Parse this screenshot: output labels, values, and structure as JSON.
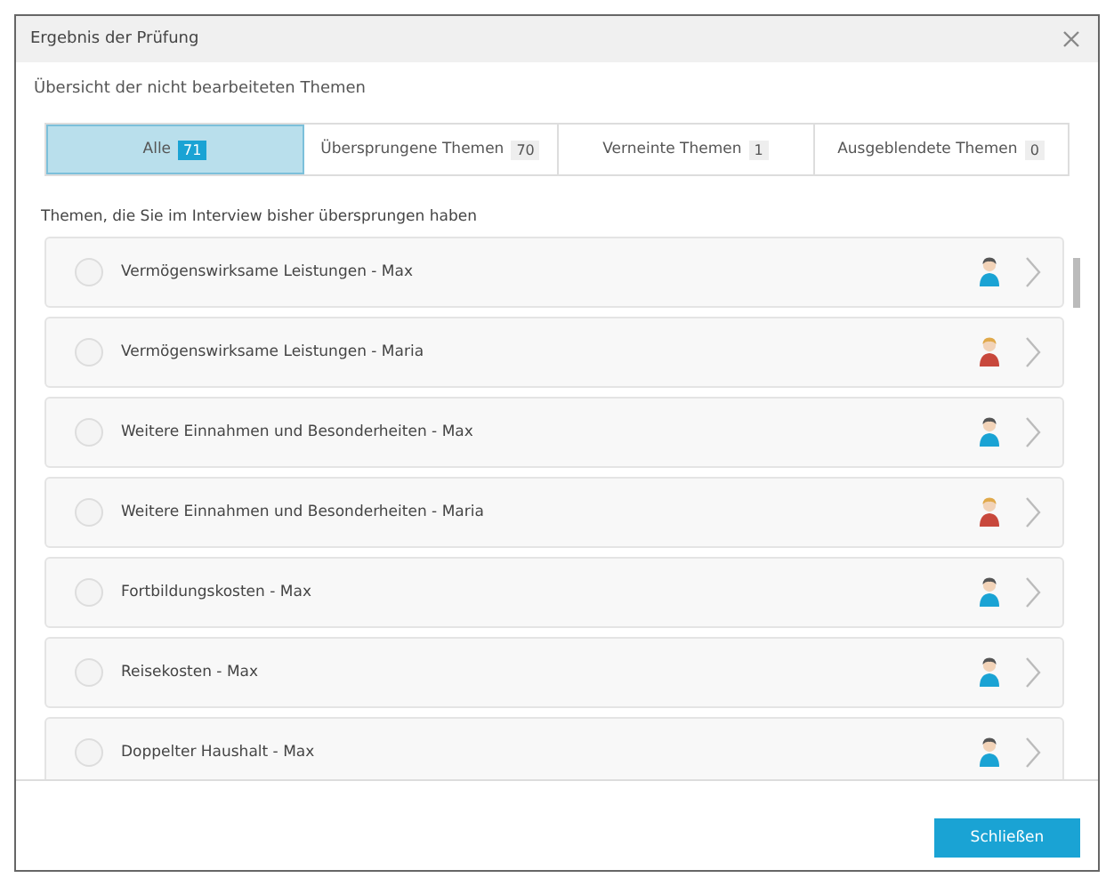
{
  "window": {
    "title": "Ergebnis der Prüfung"
  },
  "subtitle": "Übersicht der nicht bearbeiteten Themen",
  "tabs": [
    {
      "label": "Alle",
      "count": "71",
      "selected": true
    },
    {
      "label": "Übersprungene Themen",
      "count": "70",
      "selected": false
    },
    {
      "label": "Verneinte Themen",
      "count": "1",
      "selected": false
    },
    {
      "label": "Ausgeblendete Themen",
      "count": "0",
      "selected": false
    }
  ],
  "section_heading": "Themen, die Sie im Interview bisher übersprungen haben",
  "items": [
    {
      "label": "Vermögenswirksame Leistungen - Max",
      "kind": "male",
      "checked": false
    },
    {
      "label": "Vermögenswirksame Leistungen - Maria",
      "kind": "female",
      "checked": false
    },
    {
      "label": "Weitere Einnahmen und Besonderheiten - Max",
      "kind": "male",
      "checked": false
    },
    {
      "label": "Weitere Einnahmen und Besonderheiten - Maria",
      "kind": "female",
      "checked": false
    },
    {
      "label": "Fortbildungskosten - Max",
      "kind": "male",
      "checked": false
    },
    {
      "label": "Reisekosten - Max",
      "kind": "male",
      "checked": false
    },
    {
      "label": "Doppelter Haushalt - Max",
      "kind": "male",
      "checked": false
    }
  ],
  "buttons": [
    {
      "label": "Schließen"
    }
  ]
}
